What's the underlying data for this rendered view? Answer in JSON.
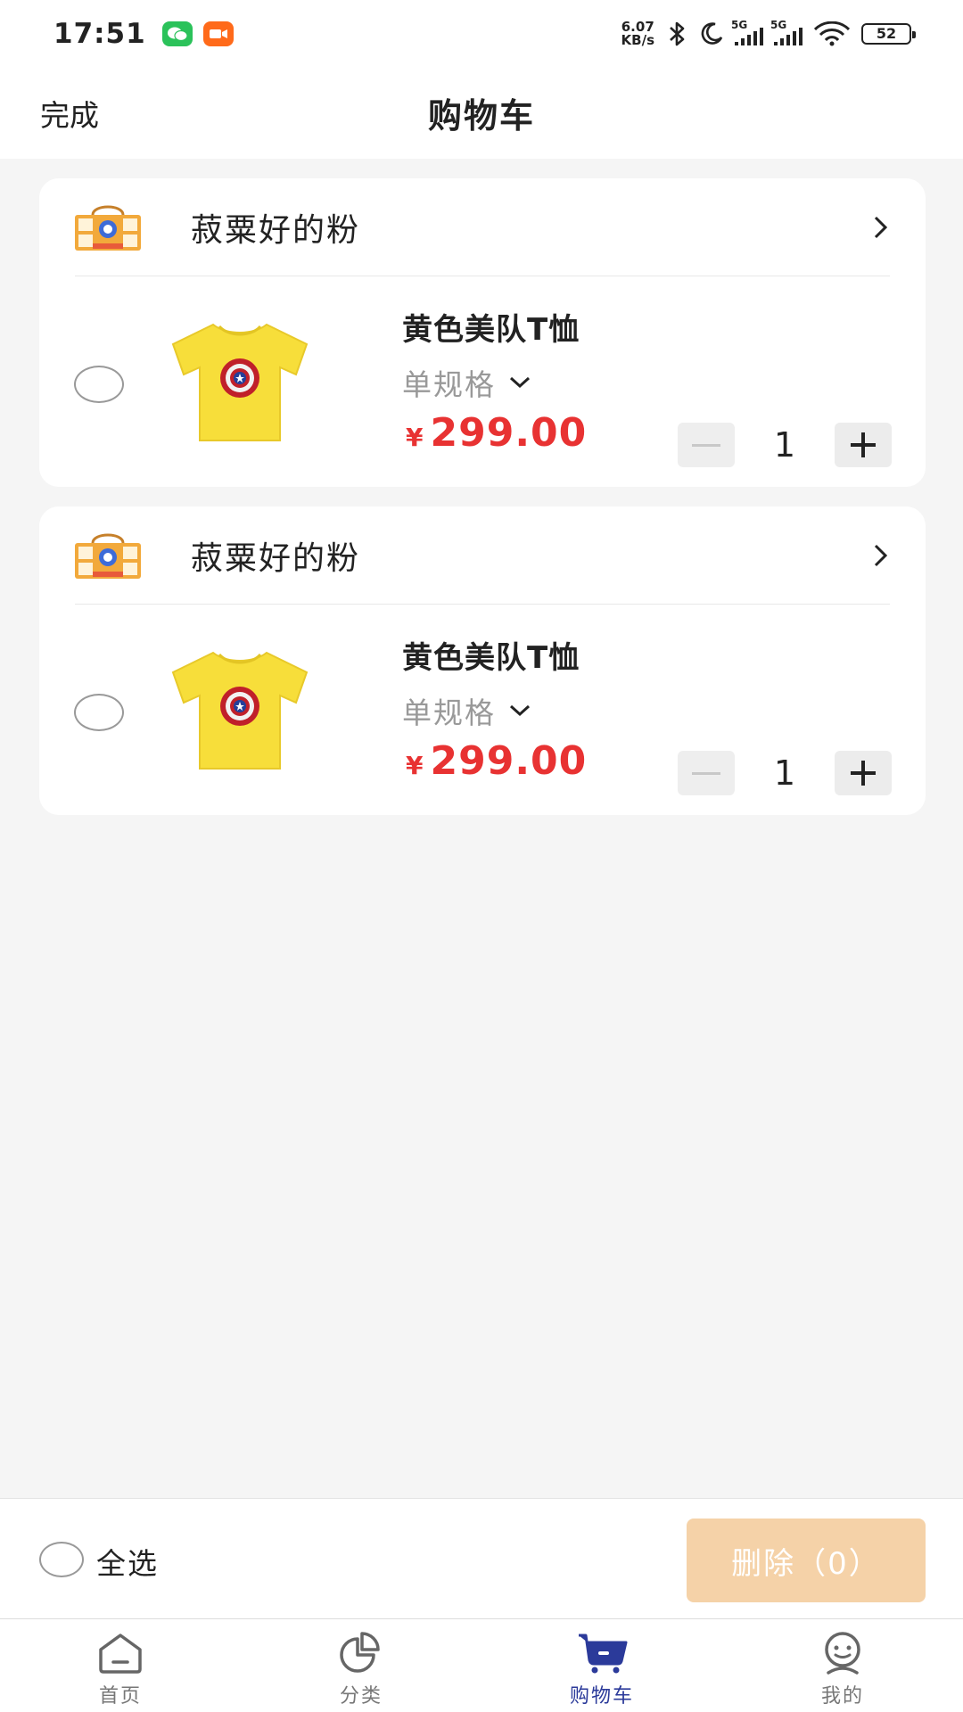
{
  "status_bar": {
    "time": "17:51",
    "net_speed_value": "6.07",
    "net_speed_unit": "KB/s",
    "signal_1_label": "5G",
    "signal_2_label": "5G",
    "battery": "52",
    "icons": [
      "wechat-icon",
      "video-icon",
      "bluetooth-icon",
      "moon-icon",
      "signal-icon",
      "wifi-icon",
      "battery-icon"
    ]
  },
  "header": {
    "done_label": "完成",
    "title": "购物车"
  },
  "cart": {
    "stores": [
      {
        "name": "菽粟好的粉",
        "items": [
          {
            "title": "黄色美队T恤",
            "spec": "单规格",
            "currency": "¥",
            "price": "299.00",
            "quantity": "1"
          }
        ]
      },
      {
        "name": "菽粟好的粉",
        "items": [
          {
            "title": "黄色美队T恤",
            "spec": "单规格",
            "currency": "¥",
            "price": "299.00",
            "quantity": "1"
          }
        ]
      }
    ]
  },
  "action_bar": {
    "select_all_label": "全选",
    "delete_label": "删除（0）",
    "delete_color": "#f5d2a8"
  },
  "tabs": [
    {
      "label": "首页",
      "icon": "home-icon",
      "active": false
    },
    {
      "label": "分类",
      "icon": "category-icon",
      "active": false
    },
    {
      "label": "购物车",
      "icon": "cart-icon",
      "active": true
    },
    {
      "label": "我的",
      "icon": "profile-icon",
      "active": false
    }
  ],
  "colors": {
    "price": "#e83232",
    "active_tab": "#2b3a9a",
    "background": "#f5f5f5"
  }
}
